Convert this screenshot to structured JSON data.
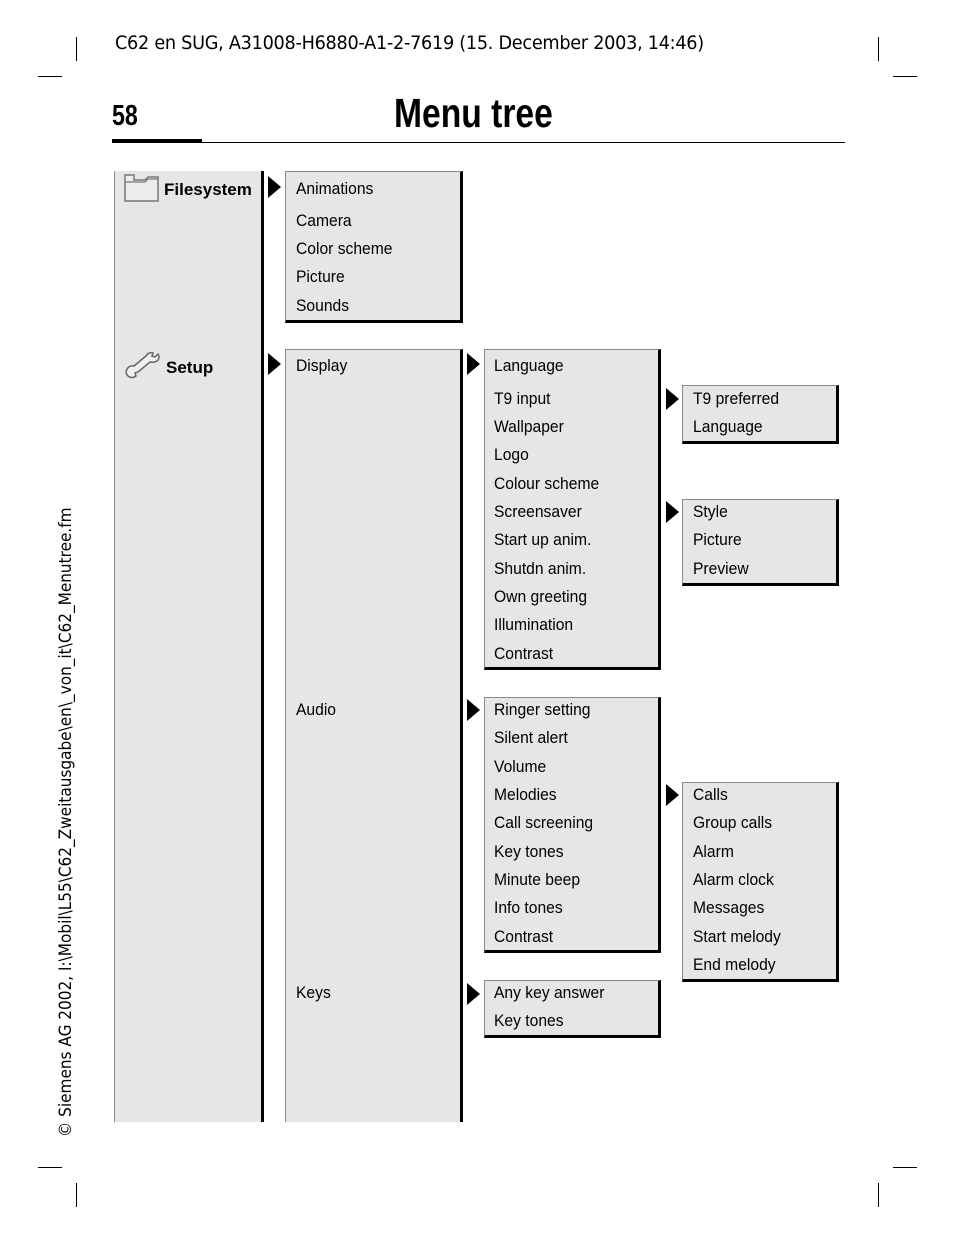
{
  "header": {
    "doc_info": "C62 en SUG, A31008-H6880-A1-2-7619 (15. December 2003, 14:46)",
    "page_number": "58",
    "title": "Menu tree"
  },
  "side_note": "© Siemens AG 2002, I:\\Mobil\\L55\\C62_Zweitausgabe\\en\\_von_it\\C62_Menutree.fm",
  "tree": {
    "filesystem": {
      "label": "Filesystem",
      "icon": "folder-icon",
      "items": [
        "Animations",
        "Camera",
        "Color scheme",
        "Picture",
        "Sounds"
      ]
    },
    "setup": {
      "label": "Setup",
      "icon": "wrench-icon",
      "items": [
        "Display",
        "Audio",
        "Keys"
      ],
      "display": {
        "items": [
          "Language",
          "T9 input",
          "Wallpaper",
          "Logo",
          "Colour scheme",
          "Screensaver",
          "Start up anim.",
          "Shutdn anim.",
          "Own greeting",
          "Illumination",
          "Contrast"
        ],
        "t9_input": {
          "items": [
            "T9 preferred",
            "Language"
          ]
        },
        "screensaver": {
          "items": [
            "Style",
            "Picture",
            "Preview"
          ]
        }
      },
      "audio": {
        "items": [
          "Ringer setting",
          "Silent alert",
          "Volume",
          "Melodies",
          "Call screening",
          "Key tones",
          "Minute beep",
          "Info tones",
          "Contrast"
        ],
        "melodies": {
          "items": [
            "Calls",
            "Group calls",
            "Alarm",
            "Alarm clock",
            "Messages",
            "Start melody",
            "End melody"
          ]
        }
      },
      "keys": {
        "items": [
          "Any key answer",
          "Key tones"
        ]
      }
    }
  }
}
